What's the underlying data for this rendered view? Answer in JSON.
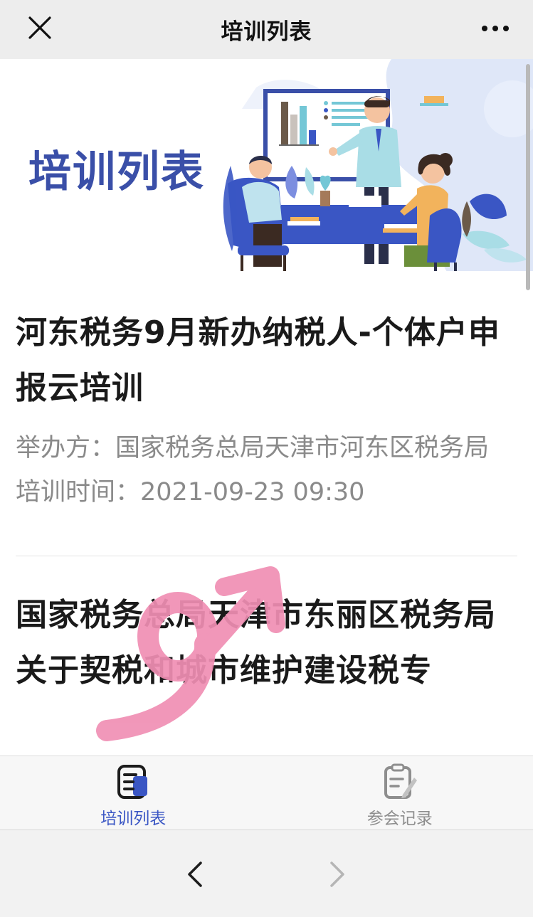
{
  "header": {
    "title": "培训列表",
    "close_icon": "close-icon",
    "more_icon": "more-icon"
  },
  "banner": {
    "title": "培训列表"
  },
  "trainings": [
    {
      "title": "河东税务9月新办纳税人-个体户申报云培训",
      "organizer_label": "举办方：",
      "organizer": "国家税务总局天津市河东区税务局",
      "time_label": "培训时间：",
      "time": "2021-09-23 09:30"
    },
    {
      "title": "国家税务总局天津市东丽区税务局关于契税和城市维护建设税专"
    }
  ],
  "tabbar": {
    "tabs": [
      {
        "label": "培训列表",
        "icon": "list-document-icon",
        "active": true
      },
      {
        "label": "参会记录",
        "icon": "clipboard-edit-icon",
        "active": false
      }
    ]
  },
  "browser_nav": {
    "back_icon": "chevron-left-icon",
    "forward_icon": "chevron-right-icon"
  },
  "colors": {
    "accent": "#3a56c4",
    "banner_title": "#3a4fa8",
    "doodle": "#f08fb4"
  }
}
